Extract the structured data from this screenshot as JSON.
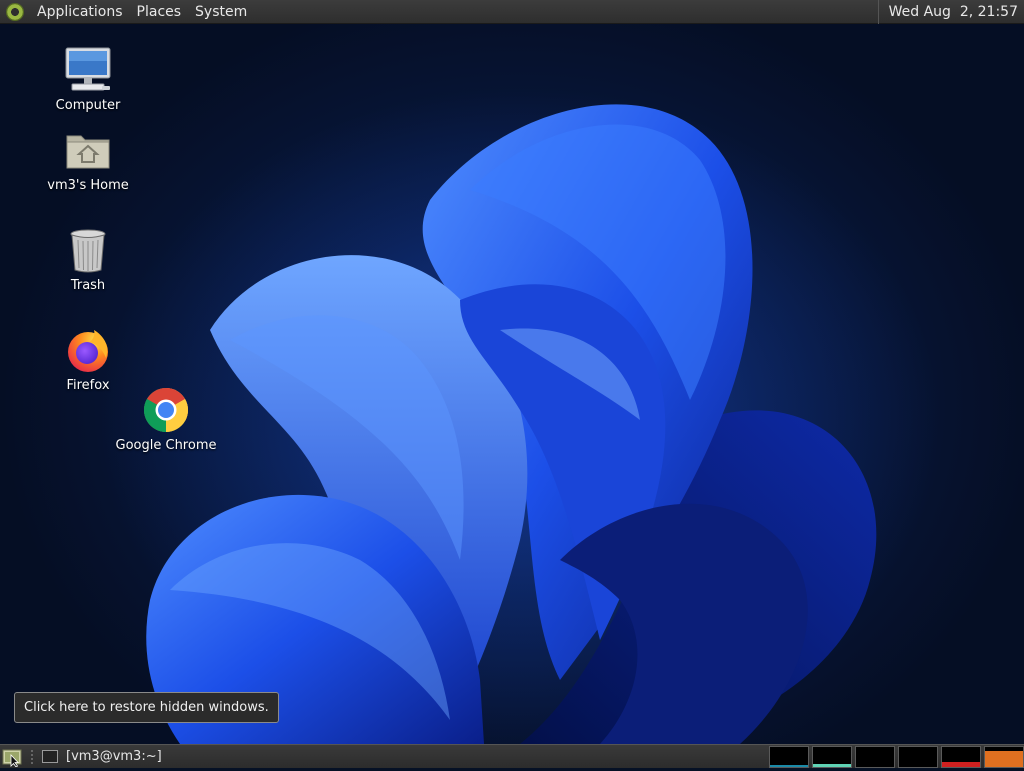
{
  "top_panel": {
    "menus": [
      "Applications",
      "Places",
      "System"
    ],
    "clock": "Wed Aug  2, 21:57"
  },
  "desktop": {
    "icons": [
      {
        "label": "Computer",
        "icon": "computer-icon"
      },
      {
        "label": "vm3's Home",
        "icon": "home-folder-icon"
      },
      {
        "label": "Trash",
        "icon": "trash-icon"
      },
      {
        "label": "Firefox",
        "icon": "firefox-icon"
      },
      {
        "label": "Google Chrome",
        "icon": "chrome-icon"
      }
    ]
  },
  "tooltip": {
    "text": "Click here to restore hidden windows."
  },
  "bottom_panel": {
    "task_label": "[vm3@vm3:~]",
    "monitors": [
      {
        "name": "cpu-monitor",
        "color": "#1a8aa8",
        "level": 0.1
      },
      {
        "name": "memory-monitor",
        "color": "#5fd3b5",
        "level": 0.15
      },
      {
        "name": "network-monitor",
        "color": "#3a3a3a",
        "level": 0.0
      },
      {
        "name": "swap-monitor",
        "color": "#3a3a3a",
        "level": 0.0
      },
      {
        "name": "load-monitor",
        "color": "#d02020",
        "level": 0.25
      },
      {
        "name": "disk-monitor",
        "color": "#e07020",
        "level": 0.8
      }
    ]
  },
  "colors": {
    "panel_bg": "#2e2e2e",
    "wallpaper_accent": "#1f5eff"
  }
}
